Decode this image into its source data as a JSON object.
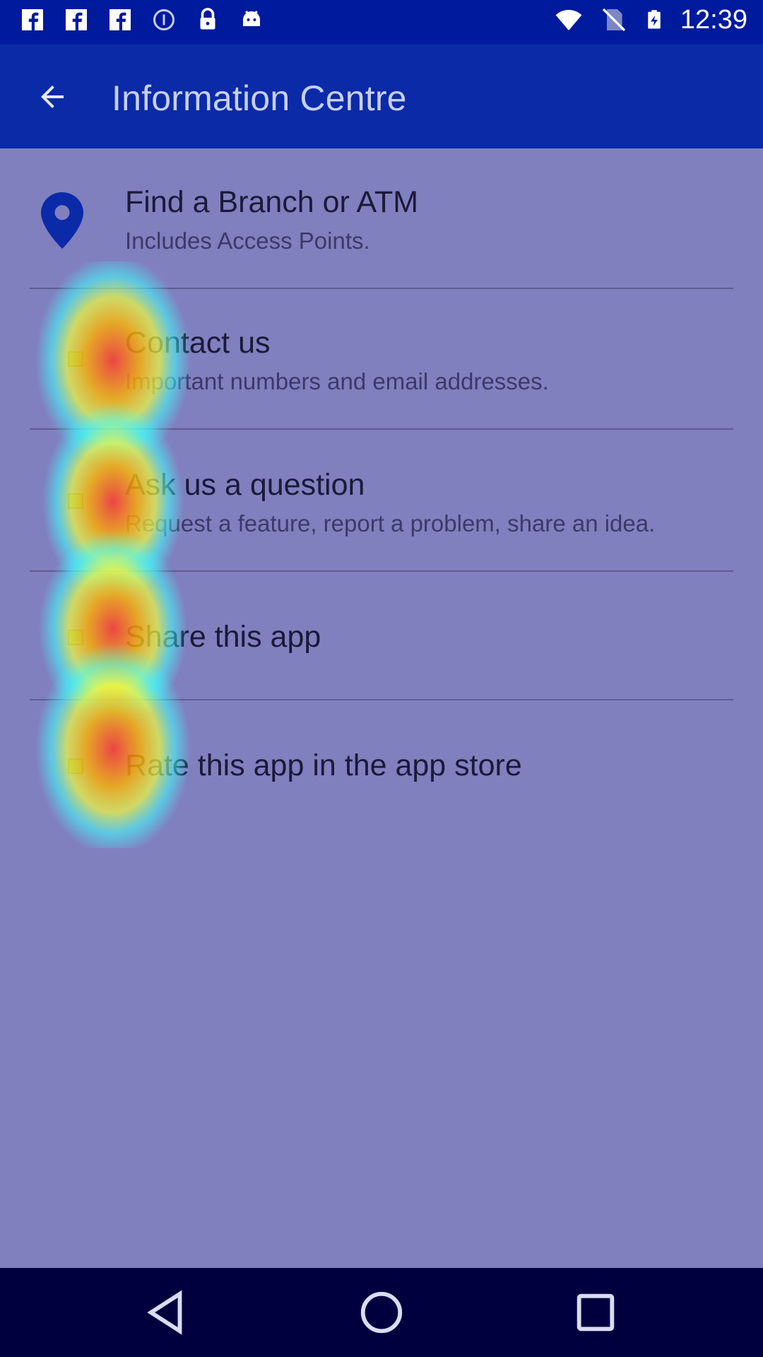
{
  "status_bar": {
    "time": "12:39",
    "left_icons": [
      "facebook-icon",
      "facebook-icon",
      "facebook-icon",
      "info-icon",
      "lock-icon",
      "android-icon"
    ],
    "right_icons": [
      "wifi-icon",
      "no-sim-icon",
      "battery-charging-icon"
    ]
  },
  "app_bar": {
    "title": "Information Centre",
    "back_icon": "arrow-back-icon"
  },
  "menu": {
    "items": [
      {
        "title": "Find a Branch or ATM",
        "subtitle": "Includes Access Points.",
        "icon": "location-pin-icon"
      },
      {
        "title": "Contact us",
        "subtitle": "Important numbers and email addresses.",
        "icon": "broken-image-icon"
      },
      {
        "title": "Ask us a question",
        "subtitle": "Request a feature, report a problem, share an idea.",
        "icon": "broken-image-icon"
      },
      {
        "title": "Share this app",
        "subtitle": "",
        "icon": "broken-image-icon"
      },
      {
        "title": "Rate this app in the app store",
        "subtitle": "",
        "icon": "broken-image-icon"
      }
    ]
  },
  "nav_bar": {
    "buttons": [
      "back-triangle-icon",
      "home-circle-icon",
      "recents-square-icon"
    ]
  },
  "colors": {
    "status_bar": "#001a9e",
    "app_bar": "#0a2aa8",
    "content_bg": "#8080bf",
    "nav_bar": "#00003f",
    "pin": "#0a2aa8"
  }
}
